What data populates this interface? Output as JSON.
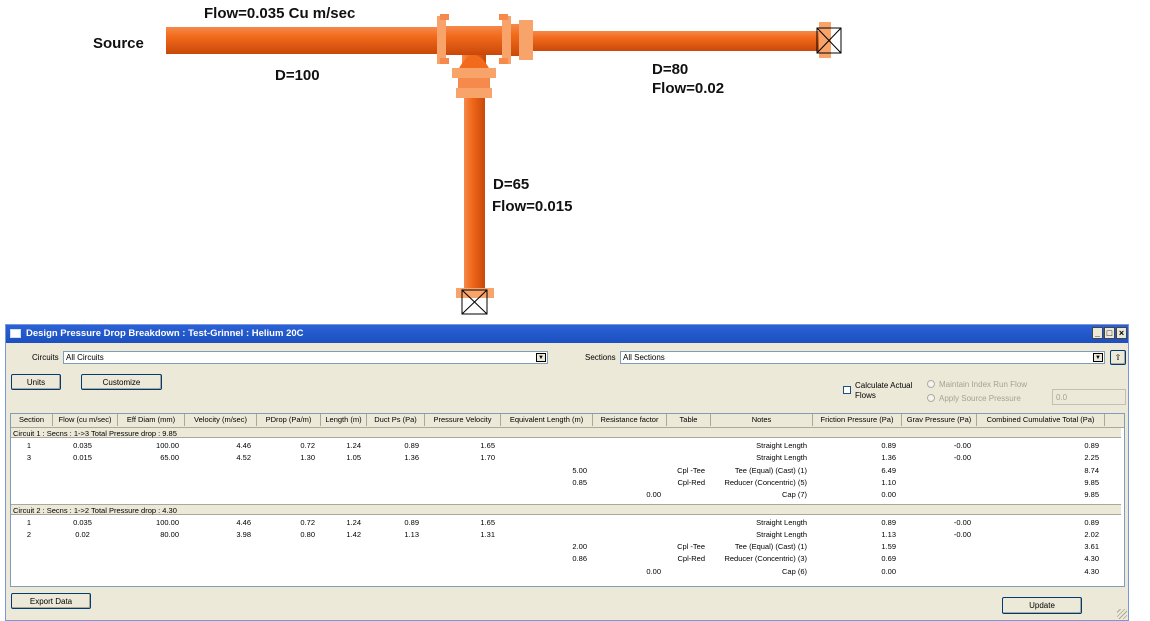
{
  "diagram": {
    "labels": {
      "flow_main": "Flow=0.035 Cu m/sec",
      "source": "Source",
      "d_main": "D=100",
      "d_right": "D=80",
      "flow_right": "Flow=0.02",
      "d_down": "D=65",
      "flow_down": "Flow=0.015"
    },
    "colors": {
      "pipe": "#f26a1b",
      "pipe_dark": "#d14e0c",
      "flange": "#f7a36a"
    }
  },
  "window": {
    "title": "Design Pressure Drop Breakdown : Test-Grinnel : Helium 20C",
    "buttons": {
      "minimize": "_",
      "maximize": "□",
      "close": "×"
    },
    "circuits_label": "Circuits",
    "circuits_value": "All Circuits",
    "sections_label": "Sections",
    "sections_value": "All Sections",
    "units_button": "Units",
    "customize_button": "Customize",
    "calc_actual_flows_line1": "Calculate Actual",
    "calc_actual_flows_line2": "Flows",
    "maintain_index": "Maintain Index Run Flow",
    "apply_source": "Apply Source Pressure",
    "source_pressure_value": "0.0",
    "export_button": "Export Data",
    "update_button": "Update"
  },
  "table": {
    "headers": [
      "Section",
      "Flow (cu m/sec)",
      "Eff Diam (mm)",
      "Velocity (m/sec)",
      "PDrop (Pa/m)",
      "Length (m)",
      "Duct Ps (Pa)",
      "Pressure Velocity",
      "Equivalent Length (m)",
      "Resistance factor",
      "Table",
      "Notes",
      "Friction Pressure (Pa)",
      "Grav Pressure (Pa)",
      "Combined Cumulative Total (Pa)"
    ],
    "groups": [
      {
        "title": "Circuit 1 : Secns : 1->3 Total Pressure drop : 9.85",
        "rows": [
          [
            "1",
            "0.035",
            "100.00",
            "4.46",
            "0.72",
            "1.24",
            "0.89",
            "1.65",
            "",
            "",
            "",
            "Straight Length",
            "0.89",
            "-0.00",
            "0.89"
          ],
          [
            "3",
            "0.015",
            "65.00",
            "4.52",
            "1.30",
            "1.05",
            "1.36",
            "1.70",
            "",
            "",
            "",
            "Straight Length",
            "1.36",
            "-0.00",
            "2.25"
          ],
          [
            "",
            "",
            "",
            "",
            "",
            "",
            "",
            "",
            "5.00",
            "",
            "Cpl -Tee",
            "Tee (Equal) (Cast)  (1)",
            "6.49",
            "",
            "8.74"
          ],
          [
            "",
            "",
            "",
            "",
            "",
            "",
            "",
            "",
            "0.85",
            "",
            "Cpl-Red",
            "Reducer (Concentric)  (5)",
            "1.10",
            "",
            "9.85"
          ],
          [
            "",
            "",
            "",
            "",
            "",
            "",
            "",
            "",
            "",
            "0.00",
            "",
            "Cap  (7)",
            "0.00",
            "",
            "9.85"
          ]
        ]
      },
      {
        "title": "Circuit 2 : Secns : 1->2 Total Pressure drop : 4.30",
        "rows": [
          [
            "1",
            "0.035",
            "100.00",
            "4.46",
            "0.72",
            "1.24",
            "0.89",
            "1.65",
            "",
            "",
            "",
            "Straight Length",
            "0.89",
            "-0.00",
            "0.89"
          ],
          [
            "2",
            "0.02",
            "80.00",
            "3.98",
            "0.80",
            "1.42",
            "1.13",
            "1.31",
            "",
            "",
            "",
            "Straight Length",
            "1.13",
            "-0.00",
            "2.02"
          ],
          [
            "",
            "",
            "",
            "",
            "",
            "",
            "",
            "",
            "2.00",
            "",
            "Cpl -Tee",
            "Tee (Equal) (Cast)  (1)",
            "1.59",
            "",
            "3.61"
          ],
          [
            "",
            "",
            "",
            "",
            "",
            "",
            "",
            "",
            "0.86",
            "",
            "Cpl-Red",
            "Reducer (Concentric)  (3)",
            "0.69",
            "",
            "4.30"
          ],
          [
            "",
            "",
            "",
            "",
            "",
            "",
            "",
            "",
            "",
            "0.00",
            "",
            "Cap  (6)",
            "0.00",
            "",
            "4.30"
          ]
        ]
      }
    ]
  }
}
